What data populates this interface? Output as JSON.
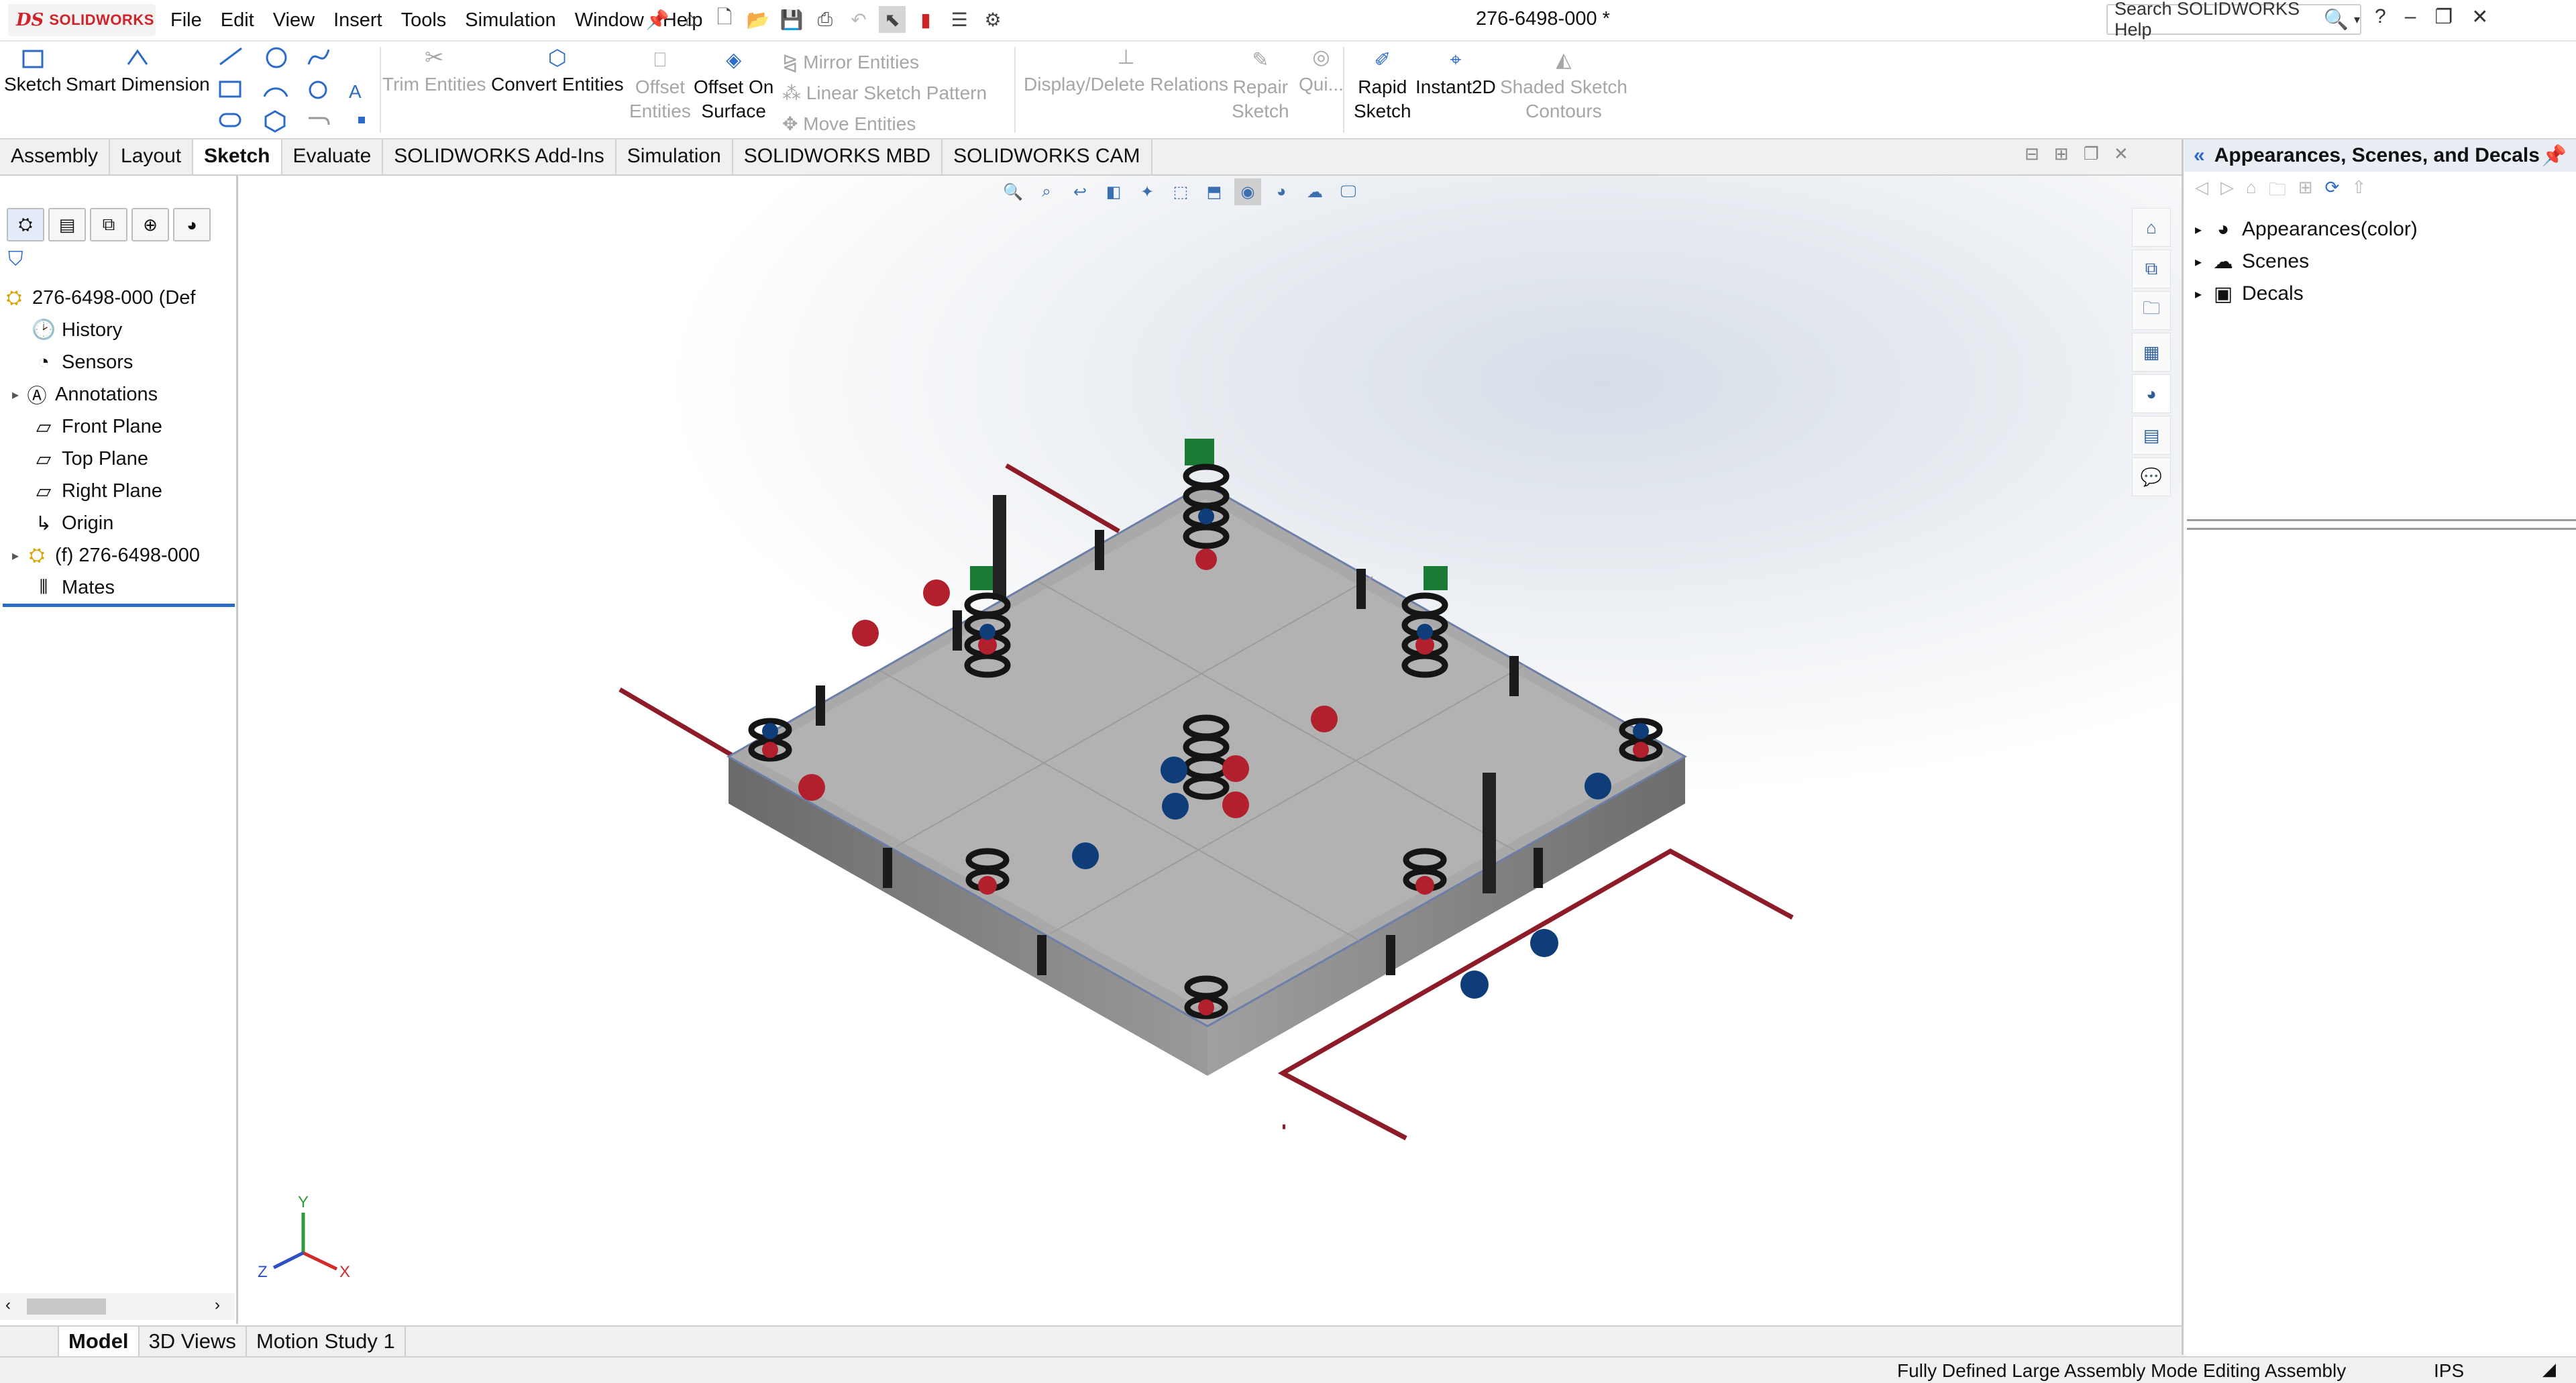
{
  "app": {
    "logo_text": "SOLIDWORKS",
    "doc_title": "276-6498-000 *"
  },
  "menu": [
    "File",
    "Edit",
    "View",
    "Insert",
    "Tools",
    "Simulation",
    "Window",
    "Help"
  ],
  "search": {
    "placeholder": "Search SOLIDWORKS Help"
  },
  "toolbar": {
    "sketch": "Sketch",
    "smart_dimension": "Smart Dimension",
    "trim_entities": "Trim Entities",
    "convert_entities": "Convert Entities",
    "offset_entities_1": "Offset",
    "offset_entities_2": "Entities",
    "offset_on_surface_1": "Offset On",
    "offset_on_surface_2": "Surface",
    "mirror_entities": "Mirror Entities",
    "linear_sketch_pattern": "Linear Sketch Pattern",
    "move_entities": "Move Entities",
    "display_delete_relations": "Display/Delete Relations",
    "repair_sketch_1": "Repair",
    "repair_sketch_2": "Sketch",
    "quick_snaps": "Qui...",
    "rapid_sketch_1": "Rapid",
    "rapid_sketch_2": "Sketch",
    "instant2d": "Instant2D",
    "shaded_sketch_contours_1": "Shaded Sketch",
    "shaded_sketch_contours_2": "Contours"
  },
  "tabs": [
    {
      "label": "Assembly"
    },
    {
      "label": "Layout"
    },
    {
      "label": "Sketch",
      "active": true
    },
    {
      "label": "Evaluate"
    },
    {
      "label": "SOLIDWORKS Add-Ins"
    },
    {
      "label": "Simulation"
    },
    {
      "label": "SOLIDWORKS MBD"
    },
    {
      "label": "SOLIDWORKS CAM"
    }
  ],
  "tree": {
    "root": "276-6498-000  (Def",
    "items": [
      "History",
      "Sensors",
      "Annotations",
      "Front Plane",
      "Top Plane",
      "Right Plane",
      "Origin",
      "(f) 276-6498-000",
      "Mates"
    ]
  },
  "bottom_tabs": [
    "Model",
    "3D Views",
    "Motion Study 1"
  ],
  "status": {
    "mode": "Fully Defined Large Assembly Mode Editing Assembly",
    "units": "IPS"
  },
  "taskpane": {
    "title": "Appearances, Scenes, and Decals",
    "items": [
      "Appearances(color)",
      "Scenes",
      "Decals"
    ]
  },
  "triad": {
    "x": "X",
    "y": "Y",
    "z": "Z"
  },
  "colors": {
    "accent": "#2c6bc7",
    "brand_red": "#d2232a",
    "ball_red": "#b1202c",
    "ball_blue": "#0f3d7a",
    "line_red": "#8e1b28"
  }
}
